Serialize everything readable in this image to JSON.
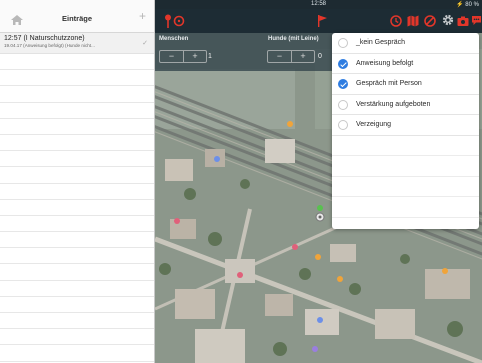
{
  "statusbar": {
    "time": "12:58",
    "battery": "⚡ 80 %"
  },
  "sidebar": {
    "title": "Einträge",
    "entries": [
      {
        "title": "12:57 (I Naturschutzzone)",
        "subtitle": "19.04.17 (Anweisung befolgt) (Hunde nicht..."
      }
    ]
  },
  "counters": {
    "people": {
      "label": "Menschen",
      "value": "1"
    },
    "dogs": {
      "label": "Hunde (mit Leine)",
      "value": "0"
    }
  },
  "options": [
    {
      "label": "_kein Gespräch",
      "checked": false
    },
    {
      "label": "Anweisung befolgt",
      "checked": true
    },
    {
      "label": "Gespräch mit Person",
      "checked": true
    },
    {
      "label": "Verstärkung aufgeboten",
      "checked": false
    },
    {
      "label": "Verzeigung",
      "checked": false
    }
  ],
  "colors": {
    "accent_red": "#e2362a",
    "check_blue": "#2f7de1",
    "toolbar": "#1d2c34"
  }
}
